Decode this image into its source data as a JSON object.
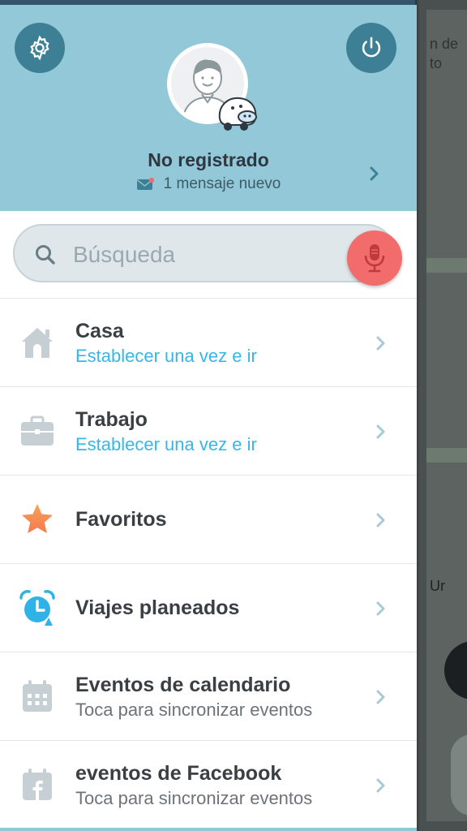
{
  "header": {
    "username": "No registrado",
    "message": "1 mensaje nuevo"
  },
  "search": {
    "placeholder": "Búsqueda"
  },
  "menu": [
    {
      "title": "Casa",
      "subtitle": "Establecer una vez e ir",
      "icon": "home-icon"
    },
    {
      "title": "Trabajo",
      "subtitle": "Establecer una vez e ir",
      "icon": "briefcase-icon"
    },
    {
      "title": "Favoritos",
      "subtitle": "",
      "icon": "star-icon"
    },
    {
      "title": "Viajes planeados",
      "subtitle": "",
      "icon": "alarm-clock-icon"
    },
    {
      "title": "Eventos de calendario",
      "subtitle": "Toca para sincronizar eventos",
      "icon": "calendar-icon"
    },
    {
      "title": "eventos de Facebook",
      "subtitle": "Toca para sincronizar eventos",
      "icon": "facebook-calendar-icon"
    }
  ],
  "map": {
    "fragment1": "n de",
    "fragment2": "to",
    "fragment3": "Ur"
  },
  "colors": {
    "header_bg": "#93c8d8",
    "accent_dark": "#3d7f94",
    "mic_red": "#f26c6c",
    "subtitle_blue": "#35b7e8"
  }
}
